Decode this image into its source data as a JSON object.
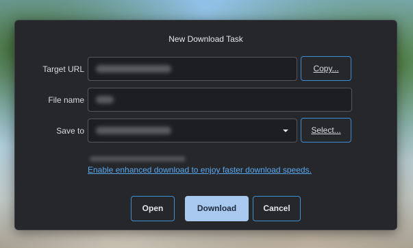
{
  "dialog": {
    "title": "New Download Task"
  },
  "fields": {
    "target_url": {
      "label": "Target URL",
      "button": "Copy..."
    },
    "file_name": {
      "label": "File name"
    },
    "save_to": {
      "label": "Save to",
      "button": "Select..."
    }
  },
  "enhanced_link": "Enable enhanced download to enjoy faster download speeds.",
  "actions": {
    "open": "Open",
    "download": "Download",
    "cancel": "Cancel"
  },
  "colors": {
    "dialog_bg": "#26272b",
    "accent": "#3c8fd8",
    "link": "#5aa8f2",
    "primary_button": "#a9c8ef"
  },
  "icons": {
    "dropdown": "chevron-down-icon"
  }
}
